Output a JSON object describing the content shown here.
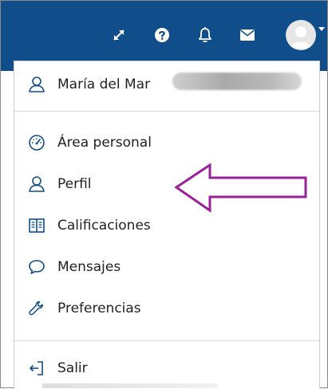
{
  "colors": {
    "navbar": "#0f4d8b",
    "icon_blue": "#0f4d8b",
    "text": "#1d2125",
    "annotation_arrow": "#9b1f9b"
  },
  "navbar": {
    "icons": [
      "expand-icon",
      "help-icon",
      "bell-icon",
      "envelope-icon",
      "avatar",
      "chevron-down-icon"
    ]
  },
  "user_menu": {
    "user_name": "María del Mar",
    "items": [
      {
        "label": "Área personal",
        "icon": "dashboard-gauge-icon"
      },
      {
        "label": "Perfil",
        "icon": "user-icon"
      },
      {
        "label": "Calificaciones",
        "icon": "grades-book-icon"
      },
      {
        "label": "Mensajes",
        "icon": "speech-bubble-icon"
      },
      {
        "label": "Preferencias",
        "icon": "wrench-icon"
      }
    ],
    "logout": {
      "label": "Salir",
      "icon": "sign-out-icon"
    }
  }
}
